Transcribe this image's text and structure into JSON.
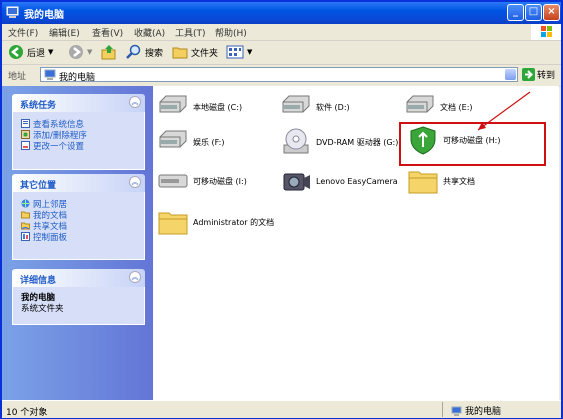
{
  "window": {
    "title": "我的电脑"
  },
  "menu": [
    "文件(F)",
    "编辑(E)",
    "查看(V)",
    "收藏(A)",
    "工具(T)",
    "帮助(H)"
  ],
  "toolbar": {
    "back": "后退",
    "search": "搜索",
    "folders": "文件夹"
  },
  "address": {
    "label": "地址",
    "value": "我的电脑",
    "go": "转到"
  },
  "sidebar": {
    "system_tasks": {
      "title": "系统任务",
      "items": [
        "查看系统信息",
        "添加/删除程序",
        "更改一个设置"
      ]
    },
    "other_places": {
      "title": "其它位置",
      "items": [
        "网上邻居",
        "我的文档",
        "共享文档",
        "控制面板"
      ]
    },
    "details": {
      "title": "详细信息",
      "name": "我的电脑",
      "desc": "系统文件夹"
    }
  },
  "items": [
    {
      "label": "本地磁盘 (C:)",
      "icon": "hard-drive-icon"
    },
    {
      "label": "软件 (D:)",
      "icon": "hard-drive-icon"
    },
    {
      "label": "文档 (E:)",
      "icon": "hard-drive-icon"
    },
    {
      "label": "娱乐 (F:)",
      "icon": "hard-drive-icon"
    },
    {
      "label": "DVD-RAM 驱动器 (G:)",
      "icon": "dvd-drive-icon"
    },
    {
      "label": "可移动磁盘 (H:)",
      "icon": "shield-drive-icon"
    },
    {
      "label": "可移动磁盘 (I:)",
      "icon": "removable-drive-icon"
    },
    {
      "label": "Lenovo EasyCamera",
      "icon": "camera-icon"
    },
    {
      "label": "共享文档",
      "icon": "folder-icon"
    },
    {
      "label": "Administrator 的文档",
      "icon": "folder-icon"
    }
  ],
  "status": {
    "count": "10 个对象",
    "location": "我的电脑"
  },
  "colors": {
    "titlebar": "#0054e3",
    "sidebar": "#7ba2e7",
    "link": "#215dc6",
    "highlight": "#d01010"
  }
}
